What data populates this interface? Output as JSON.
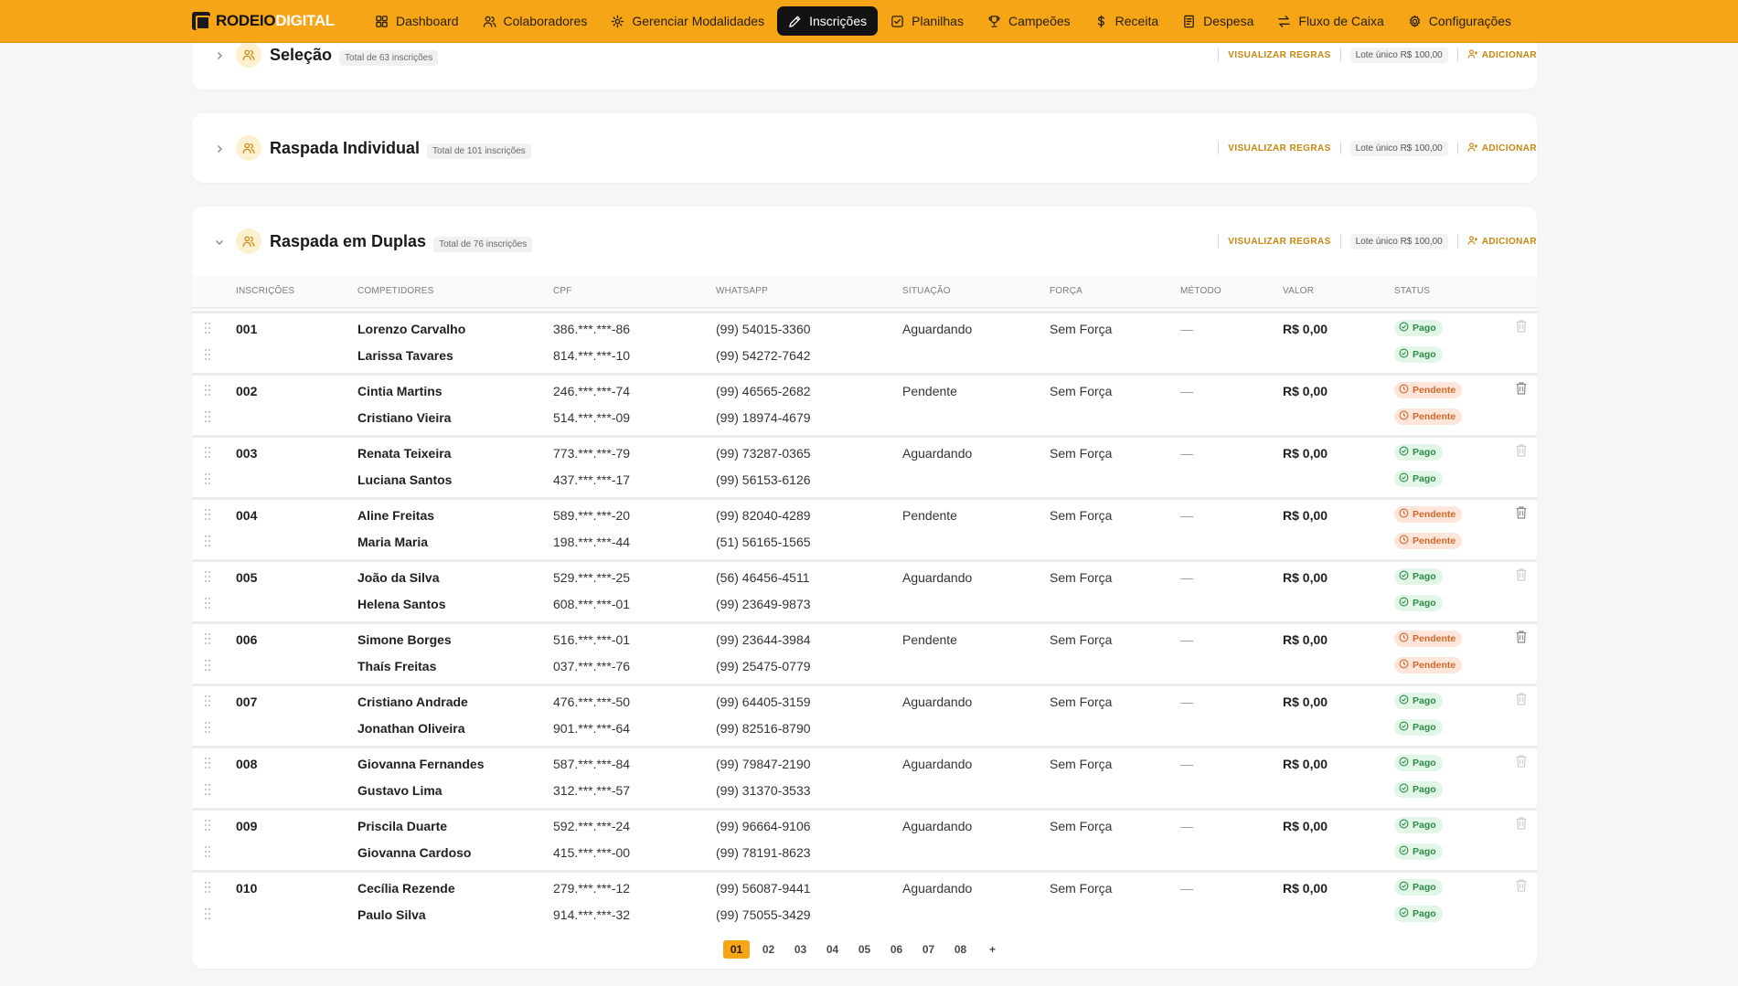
{
  "brand": {
    "part1": "RODEIO",
    "part2": "DIGITAL"
  },
  "nav": [
    {
      "label": "Dashboard",
      "icon": "grid-icon"
    },
    {
      "label": "Colaboradores",
      "icon": "users-icon"
    },
    {
      "label": "Gerenciar Modalidades",
      "icon": "gear-icon"
    },
    {
      "label": "Inscrições",
      "icon": "pen-icon",
      "active": true
    },
    {
      "label": "Planilhas",
      "icon": "checkbox-icon"
    },
    {
      "label": "Campeões",
      "icon": "trophy-icon"
    },
    {
      "label": "Receita",
      "icon": "dollar-icon"
    },
    {
      "label": "Despesa",
      "icon": "receipt-icon"
    },
    {
      "label": "Fluxo de Caixa",
      "icon": "transfer-icon"
    },
    {
      "label": "Configurações",
      "icon": "settings-icon"
    }
  ],
  "modalities": [
    {
      "title": "Seleção",
      "total": "Total de 63 inscrições",
      "rules": "VISUALIZAR REGRAS",
      "lote": "Lote único R$ 100,00",
      "add": "ADICIONAR",
      "expanded": false
    },
    {
      "title": "Raspada Individual",
      "total": "Total de 101 inscrições",
      "rules": "VISUALIZAR REGRAS",
      "lote": "Lote único R$ 100,00",
      "add": "ADICIONAR",
      "expanded": false
    },
    {
      "title": "Raspada em Duplas",
      "total": "Total de 76 inscrições",
      "rules": "VISUALIZAR REGRAS",
      "lote": "Lote único R$ 100,00",
      "add": "ADICIONAR",
      "expanded": true
    }
  ],
  "table": {
    "headers": [
      "INSCRIÇÕES",
      "COMPETIDORES",
      "CPF",
      "WHATSAPP",
      "SITUAÇÃO",
      "FORÇA",
      "MÉTODO",
      "VALOR",
      "STATUS"
    ],
    "entries": [
      {
        "num": "001",
        "situacao": "Aguardando",
        "forca": "Sem Força",
        "metodo": "—",
        "valor": "R$ 0,00",
        "status": "Pago",
        "competitors": [
          {
            "name": "Lorenzo Carvalho",
            "cpf": "386.***.***-86",
            "whatsapp": "(99) 54015-3360"
          },
          {
            "name": "Larissa Tavares",
            "cpf": "814.***.***-10",
            "whatsapp": "(99) 54272-7642"
          }
        ]
      },
      {
        "num": "002",
        "situacao": "Pendente",
        "forca": "Sem Força",
        "metodo": "—",
        "valor": "R$ 0,00",
        "status": "Pendente",
        "competitors": [
          {
            "name": "Cintia Martins",
            "cpf": "246.***.***-74",
            "whatsapp": "(99) 46565-2682"
          },
          {
            "name": "Cristiano Vieira",
            "cpf": "514.***.***-09",
            "whatsapp": "(99) 18974-4679"
          }
        ]
      },
      {
        "num": "003",
        "situacao": "Aguardando",
        "forca": "Sem Força",
        "metodo": "—",
        "valor": "R$ 0,00",
        "status": "Pago",
        "competitors": [
          {
            "name": "Renata Teixeira",
            "cpf": "773.***.***-79",
            "whatsapp": "(99) 73287-0365"
          },
          {
            "name": "Luciana Santos",
            "cpf": "437.***.***-17",
            "whatsapp": "(99) 56153-6126"
          }
        ]
      },
      {
        "num": "004",
        "situacao": "Pendente",
        "forca": "Sem Força",
        "metodo": "—",
        "valor": "R$ 0,00",
        "status": "Pendente",
        "competitors": [
          {
            "name": "Aline Freitas",
            "cpf": "589.***.***-20",
            "whatsapp": "(99) 82040-4289"
          },
          {
            "name": "Maria Maria",
            "cpf": "198.***.***-44",
            "whatsapp": "(51) 56165-1565"
          }
        ]
      },
      {
        "num": "005",
        "situacao": "Aguardando",
        "forca": "Sem Força",
        "metodo": "—",
        "valor": "R$ 0,00",
        "status": "Pago",
        "competitors": [
          {
            "name": "João da Silva",
            "cpf": "529.***.***-25",
            "whatsapp": "(56) 46456-4511"
          },
          {
            "name": "Helena Santos",
            "cpf": "608.***.***-01",
            "whatsapp": "(99) 23649-9873"
          }
        ]
      },
      {
        "num": "006",
        "situacao": "Pendente",
        "forca": "Sem Força",
        "metodo": "—",
        "valor": "R$ 0,00",
        "status": "Pendente",
        "competitors": [
          {
            "name": "Simone Borges",
            "cpf": "516.***.***-01",
            "whatsapp": "(99) 23644-3984"
          },
          {
            "name": "Thaís Freitas",
            "cpf": "037.***.***-76",
            "whatsapp": "(99) 25475-0779"
          }
        ]
      },
      {
        "num": "007",
        "situacao": "Aguardando",
        "forca": "Sem Força",
        "metodo": "—",
        "valor": "R$ 0,00",
        "status": "Pago",
        "competitors": [
          {
            "name": "Cristiano Andrade",
            "cpf": "476.***.***-50",
            "whatsapp": "(99) 64405-3159"
          },
          {
            "name": "Jonathan Oliveira",
            "cpf": "901.***.***-64",
            "whatsapp": "(99) 82516-8790"
          }
        ]
      },
      {
        "num": "008",
        "situacao": "Aguardando",
        "forca": "Sem Força",
        "metodo": "—",
        "valor": "R$ 0,00",
        "status": "Pago",
        "competitors": [
          {
            "name": "Giovanna Fernandes",
            "cpf": "587.***.***-84",
            "whatsapp": "(99) 79847-2190"
          },
          {
            "name": "Gustavo Lima",
            "cpf": "312.***.***-57",
            "whatsapp": "(99) 31370-3533"
          }
        ]
      },
      {
        "num": "009",
        "situacao": "Aguardando",
        "forca": "Sem Força",
        "metodo": "—",
        "valor": "R$ 0,00",
        "status": "Pago",
        "competitors": [
          {
            "name": "Priscila Duarte",
            "cpf": "592.***.***-24",
            "whatsapp": "(99) 96664-9106"
          },
          {
            "name": "Giovanna Cardoso",
            "cpf": "415.***.***-00",
            "whatsapp": "(99) 78191-8623"
          }
        ]
      },
      {
        "num": "010",
        "situacao": "Aguardando",
        "forca": "Sem Força",
        "metodo": "—",
        "valor": "R$ 0,00",
        "status": "Pago",
        "competitors": [
          {
            "name": "Cecília Rezende",
            "cpf": "279.***.***-12",
            "whatsapp": "(99) 56087-9441"
          },
          {
            "name": "Paulo Silva",
            "cpf": "914.***.***-32",
            "whatsapp": "(99) 75055-3429"
          }
        ]
      }
    ]
  },
  "pagination": {
    "pages": [
      "01",
      "02",
      "03",
      "04",
      "05",
      "06",
      "07",
      "08"
    ],
    "current": "01",
    "more": "+"
  },
  "colors": {
    "accent": "#f5a515",
    "paid": "#2c8a47",
    "pending": "#d2672a"
  }
}
